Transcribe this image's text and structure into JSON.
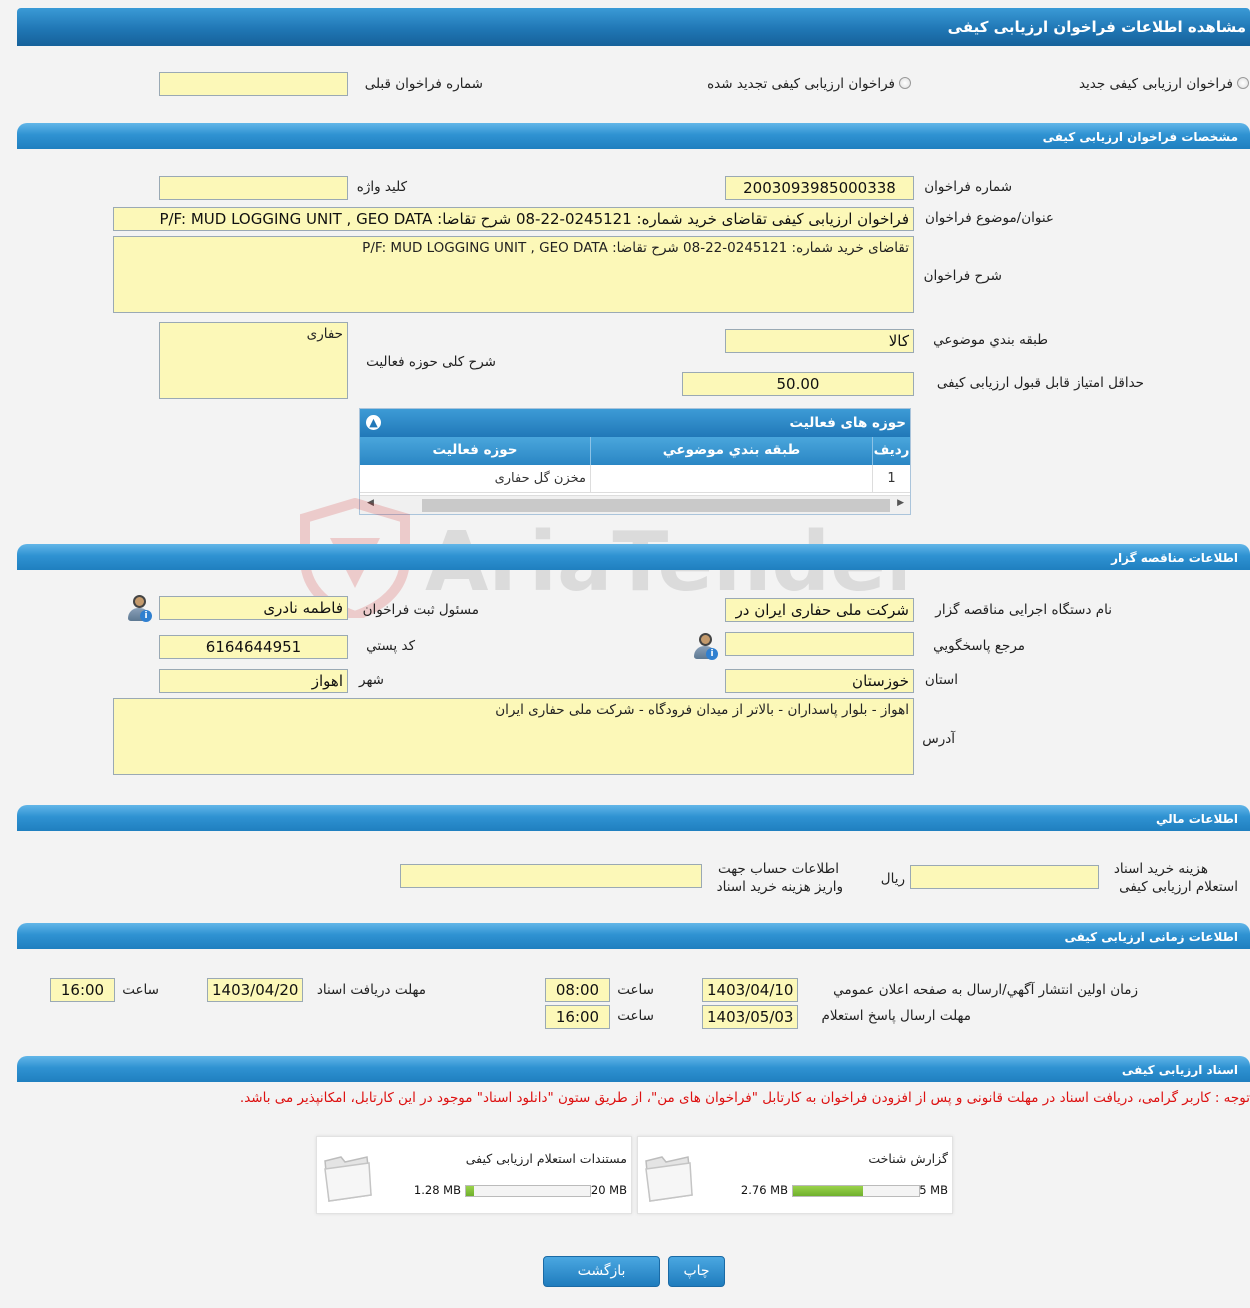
{
  "page_title": "مشاهده اطلاعات فراخوان ارزیابی کیفی",
  "call_type": {
    "new_label": "فراخوان ارزیابی کیفی جدید",
    "renewed_label": "فراخوان ارزیابی کیفی تجدید شده",
    "previous_number_label": "شماره فراخوان قبلی",
    "previous_number_value": ""
  },
  "specs": {
    "section_title": "مشخصات فراخوان ارزیابی کیفی",
    "call_number_label": "شماره فراخوان",
    "call_number_value": "2003093985000338",
    "keyword_label": "کلید واژه",
    "keyword_value": "",
    "subject_label": "عنوان/موضوع فراخوان",
    "subject_value": "فراخوان ارزیابی کیفی تقاضای خرید شماره:  0245121-22-08 شرح تقاضا: P/F: MUD LOGGING UNIT , GEO DATA",
    "description_label": "شرح فراخوان",
    "description_value": "تقاضای خرید شماره:  0245121-22-08 شرح تقاضا: P/F: MUD LOGGING UNIT , GEO DATA",
    "category_label": "طبقه بندي موضوعي",
    "category_value": "کالا",
    "activity_scope_label": "شرح کلی حوزه فعالیت",
    "activity_scope_value": "حفاری",
    "min_score_label": "حداقل امتیاز قابل قبول ارزیابی کیفی",
    "min_score_value": "50.00"
  },
  "activity_grid": {
    "title": "حوزه های فعالیت",
    "collapse_icon": "chevron-up-icon",
    "columns": [
      "رديف",
      "طبقه بندي موضوعي",
      "حوزه فعالیت"
    ],
    "rows": [
      {
        "index": "1",
        "category": "",
        "activity": "مخزن گل حفاری"
      }
    ]
  },
  "watermark_text": "AriaTender.neT",
  "organizer": {
    "section_title": "اطلاعات مناقصه گزار",
    "org_name_label": "نام دستگاه اجرایی مناقصه گزار",
    "org_name_value": "شرکت ملی حفاری ایران در",
    "registrar_label": "مسئول ثبت فراخوان",
    "registrar_value": "فاطمه نادری",
    "responder_label": "مرجع پاسخگويي",
    "responder_value": "",
    "postal_code_label": "کد پستي",
    "postal_code_value": "6164644951",
    "province_label": "استان",
    "province_value": "خوزستان",
    "city_label": "شهر",
    "city_value": "اهواز",
    "address_label": "آدرس",
    "address_value": "اهواز - بلوار پاسداران - بالاتر از میدان فرودگاه - شرکت ملی حفاری ایران"
  },
  "financial": {
    "section_title": "اطلاعات مالي",
    "doc_fee_label_1": "هزینه خرید اسناد",
    "doc_fee_label_2": "استعلام ارزیابی کیفی",
    "doc_fee_value": "",
    "currency": "ريال",
    "account_label_1": "اطلاعات حساب جهت",
    "account_label_2": "واریز هزینه خرید اسناد",
    "account_value": ""
  },
  "timing": {
    "section_title": "اطلاعات زمانی ارزیابی کیفی",
    "publish_label": "زمان اولين انتشار آگهي/ارسال به صفحه اعلان عمومي",
    "publish_date": "1403/04/10",
    "time_label": "ساعت",
    "publish_time": "08:00",
    "deadline_receive_label": "مهلت دریافت اسناد",
    "deadline_receive_date": "1403/04/20",
    "deadline_receive_time": "16:00",
    "deadline_reply_label": "مهلت ارسال پاسخ استعلام",
    "deadline_reply_date": "1403/05/03",
    "deadline_reply_time": "16:00"
  },
  "documents": {
    "section_title": "اسناد ارزیابی کیفی",
    "notice": "توجه : کاربر گرامی، دریافت اسناد در مهلت قانونی و پس از افزودن فراخوان به کارتابل \"فراخوان های من\"، از طریق ستون \"دانلود اسناد\" موجود در این کارتابل، امکانپذیر می باشد.",
    "files": [
      {
        "title": "گزارش شناخت",
        "size": "2.76 MB",
        "max": "5 MB",
        "fill_fraction": 0.552,
        "icon": "folder-icon"
      },
      {
        "title": "مستندات استعلام ارزیابی کیفی",
        "size": "1.28 MB",
        "max": "20 MB",
        "fill_fraction": 0.064,
        "icon": "folder-icon"
      }
    ]
  },
  "buttons": {
    "print": "چاپ",
    "back": "بازگشت"
  }
}
